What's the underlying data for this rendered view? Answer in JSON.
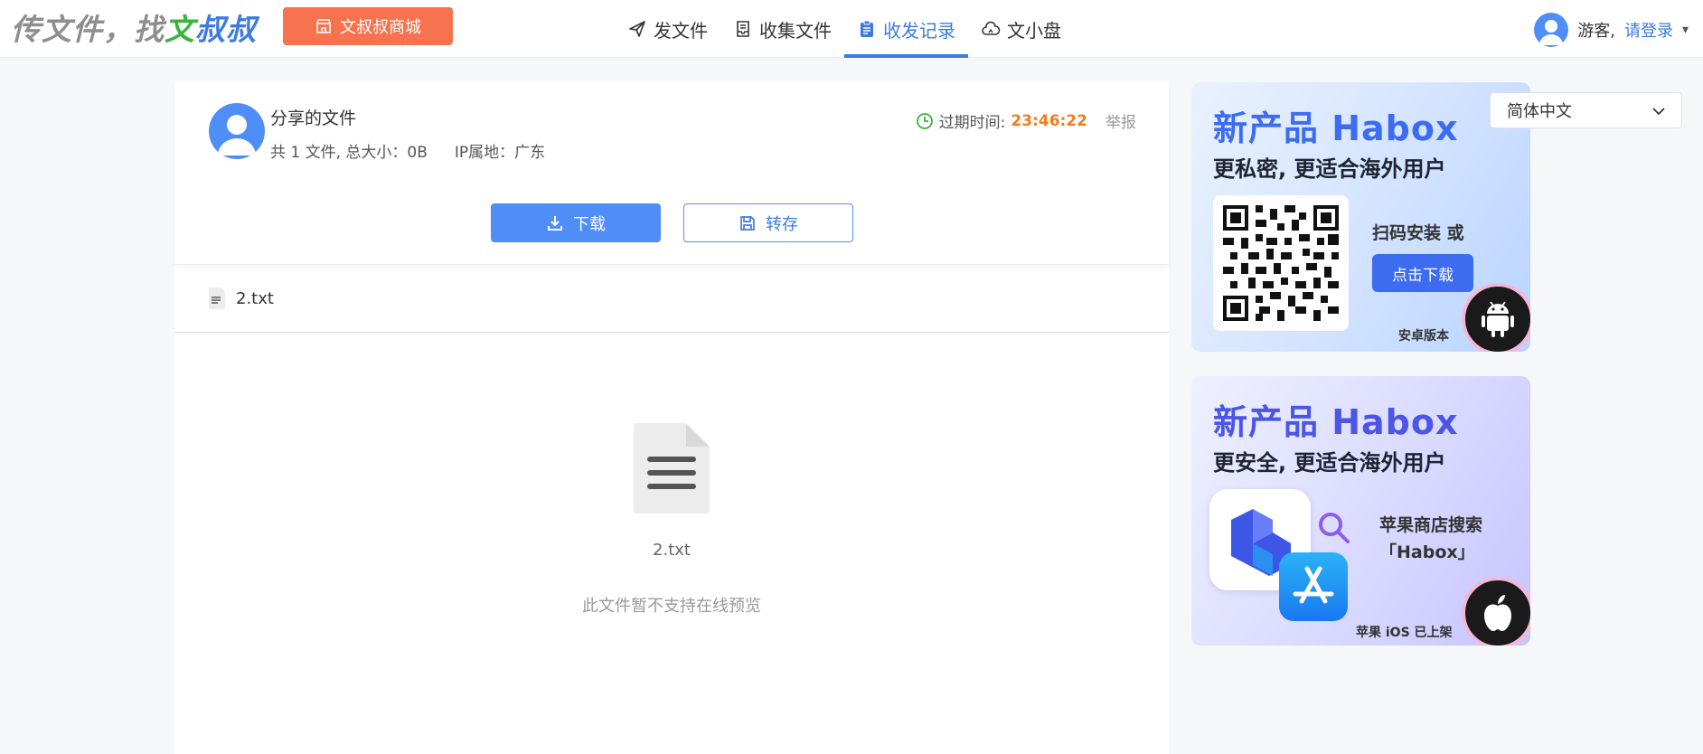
{
  "header": {
    "logo_prefix": "传文件，找",
    "logo_green": "文",
    "logo_blue": "叔叔",
    "mall_button": "文叔叔商城",
    "nav": [
      {
        "label": "发文件",
        "icon": "paper-plane-icon",
        "active": false
      },
      {
        "label": "收集文件",
        "icon": "inbox-icon",
        "active": false
      },
      {
        "label": "收发记录",
        "icon": "clipboard-icon",
        "active": true
      },
      {
        "label": "文小盘",
        "icon": "cloud-icon",
        "active": false
      }
    ],
    "guest_label": "游客,",
    "login_link": "请登录",
    "caret": "▾"
  },
  "share": {
    "title": "分享的文件",
    "file_count": "共 1 文件,  总大小：0B",
    "ip_location": "IP属地：广东",
    "expire_label": "过期时间:",
    "expire_time": "23:46:22",
    "report": "举报",
    "download_button": "下载",
    "save_button": "转存"
  },
  "file": {
    "name": "2.txt"
  },
  "preview": {
    "file_name": "2.txt",
    "message": "此文件暂不支持在线预览"
  },
  "ads": {
    "android": {
      "title": "新产品 Habox",
      "subtitle": "更私密, 更适合海外用户",
      "scan_text": "扫码安装 或",
      "button": "点击下载",
      "footer": "安卓版本"
    },
    "ios": {
      "title": "新产品 Habox",
      "subtitle": "更安全, 更适合海外用户",
      "store_line1": "苹果商店搜索",
      "store_line2": "「Habox」",
      "footer": "苹果 iOS 已上架"
    }
  },
  "language": {
    "selected": "简体中文"
  },
  "colors": {
    "accent": "#4f8ef7",
    "mall": "#f7734e",
    "expire_time": "#ef7d1a"
  }
}
